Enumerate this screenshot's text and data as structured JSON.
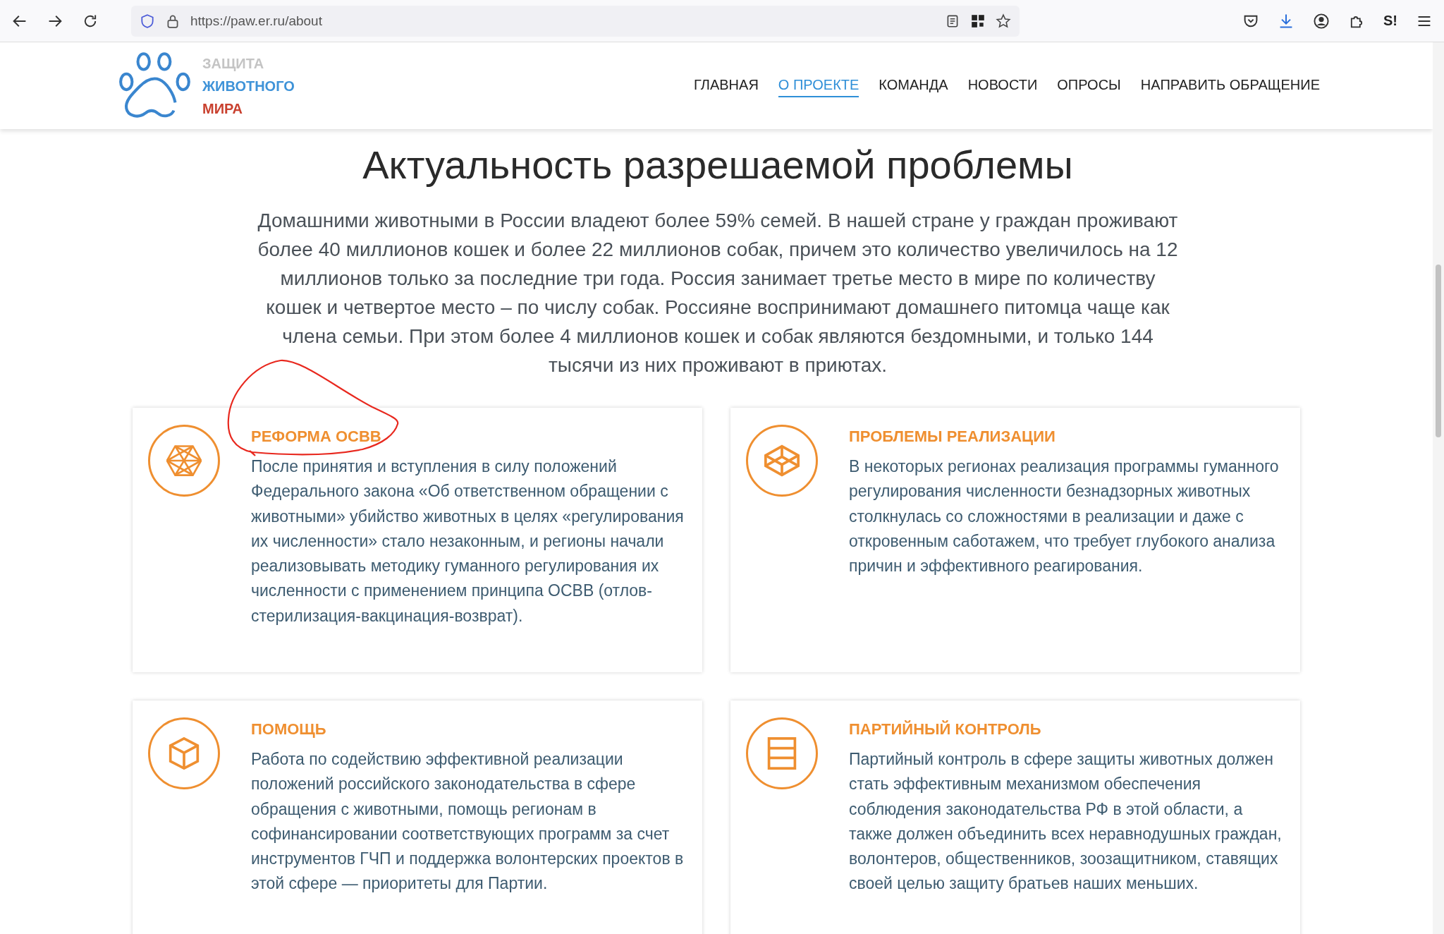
{
  "browser": {
    "url": "https://paw.er.ru/about",
    "extension_label": "S!"
  },
  "header": {
    "logo_lines": [
      {
        "text": "ЗАЩИТА",
        "color": "#c4c4c4"
      },
      {
        "text": "ЖИВОТНОГО",
        "color": "#3f93d8"
      },
      {
        "text": "МИРА",
        "color": "#c9412f"
      }
    ],
    "nav": [
      {
        "label": "ГЛАВНАЯ",
        "selected": false
      },
      {
        "label": "О ПРОЕКТЕ",
        "selected": true
      },
      {
        "label": "КОМАНДА",
        "selected": false
      },
      {
        "label": "НОВОСТИ",
        "selected": false
      },
      {
        "label": "ОПРОСЫ",
        "selected": false
      },
      {
        "label": "НАПРАВИТЬ ОБРАЩЕНИЕ",
        "selected": false
      }
    ]
  },
  "section": {
    "title": "Актуальность разрешаемой проблемы",
    "intro": "Домашними животными в России владеют более 59% семей. В нашей стране у граждан проживают более 40 миллионов кошек и более 22 миллионов собак, причем это количество увеличилось на 12 миллионов только за последние три года. Россия занимает третье место в мире по количеству кошек и четвертое место – по числу собак. Россияне воспринимают домашнего питомца чаще как члена семьи. При этом более 4 миллионов кошек и собак являются бездомными, и только 144 тысячи из них проживают в приютах."
  },
  "cards": [
    {
      "kind": "hexagon",
      "annotated": true,
      "title": "РЕФОРМА ОСВВ",
      "text": "После принятия и вступления в силу положений Федерального закона «Об ответственном обращении с животными» убийство животных в целях «регулирования их численности» стало незаконным, и регионы начали реализовывать методику гуманного регулирования их численности с применением принципа ОСВВ (отлов-стерилизация-вакцинация-возврат)."
    },
    {
      "kind": "wireframe-box",
      "annotated": false,
      "title": "ПРОБЛЕМЫ РЕАЛИЗАЦИИ",
      "text": "В некоторых регионах реализация программы гуманного регулирования численности безнадзорных животных столкнулась со сложностями в реализации и даже с откровенным саботажем, что требует глубокого анализа причин и эффективного реагирования."
    },
    {
      "kind": "cube",
      "annotated": false,
      "title": "ПОМОЩЬ",
      "text": "Работа по содействию эффективной реализации положений российского законодательства в сфере обращения с животными, помощь регионам в софинансировании соответствующих программ за счет инструментов ГЧП и поддержка волонтерских проектов в этой сфере — приоритеты для Партии."
    },
    {
      "kind": "rows",
      "annotated": false,
      "title": "ПАРТИЙНЫЙ КОНТРОЛЬ",
      "text": "Партийный контроль в сфере защиты животных должен стать эффективным механизмом обеспечения соблюдения законодательства РФ в этой области, а также должен объединить всех неравнодушных граждан, волонтеров, общественников, зоозащитником, ставящих своей целью защиту братьев наших меньших."
    }
  ]
}
